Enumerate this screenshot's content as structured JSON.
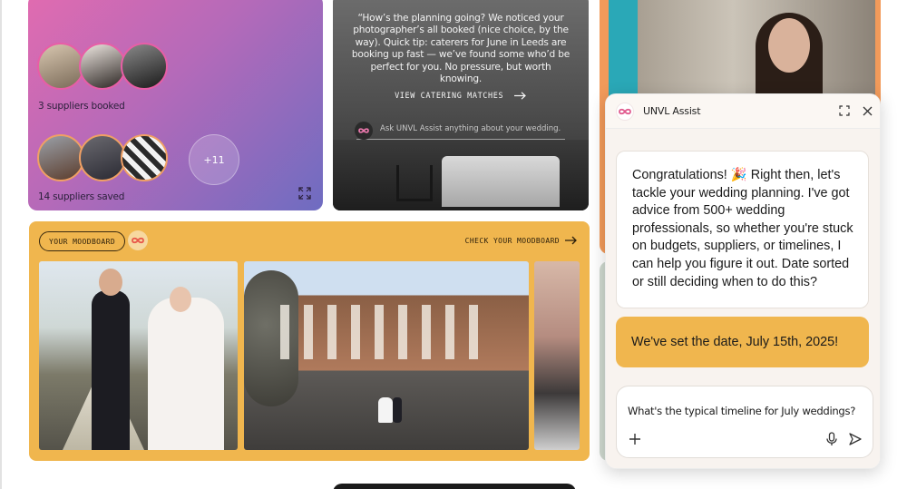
{
  "suppliers_card": {
    "booked_label": "3 suppliers booked",
    "saved_label": "14 suppliers saved",
    "more_count": "+11"
  },
  "catering_card": {
    "quote": "“How’s the planning going? We noticed your photographer’s all booked (nice choice, by the way). Quick tip: caterers for June in Leeds are booking up fast — we’ve found some who’d be perfect for you. No pressure, but worth knowing.",
    "cta_label": "VIEW CATERING MATCHES",
    "ask_placeholder": "Ask UNVL Assist anything about your wedding..."
  },
  "moodboard": {
    "title": "YOUR MOODBOARD",
    "cta_label": "CHECK YOUR MOODBOARD"
  },
  "assist": {
    "title": "UNVL Assist",
    "bot_message": "Congratulations! 🎉 Right then, let's tackle your wedding planning. I've got advice from 500+ wedding professionals, so whether you're stuck on budgets, suppliers, or timelines, I can help you figure it out. Date sorted or still deciding when to do this?",
    "user_message": "We've set the date, July 15th, 2025!",
    "composer_value": "What's the typical timeline for July weddings?"
  },
  "colors": {
    "accent_yellow": "#f0b64e",
    "gradient_pink": "#e16bb0",
    "gradient_purple": "#6e6cc1",
    "portrait_orange": "#f29a5a"
  },
  "icons": [
    "expand-icon",
    "arrow-right-icon",
    "unvl-logo-icon",
    "fullscreen-icon",
    "close-icon",
    "plus-icon",
    "microphone-icon",
    "send-icon"
  ]
}
